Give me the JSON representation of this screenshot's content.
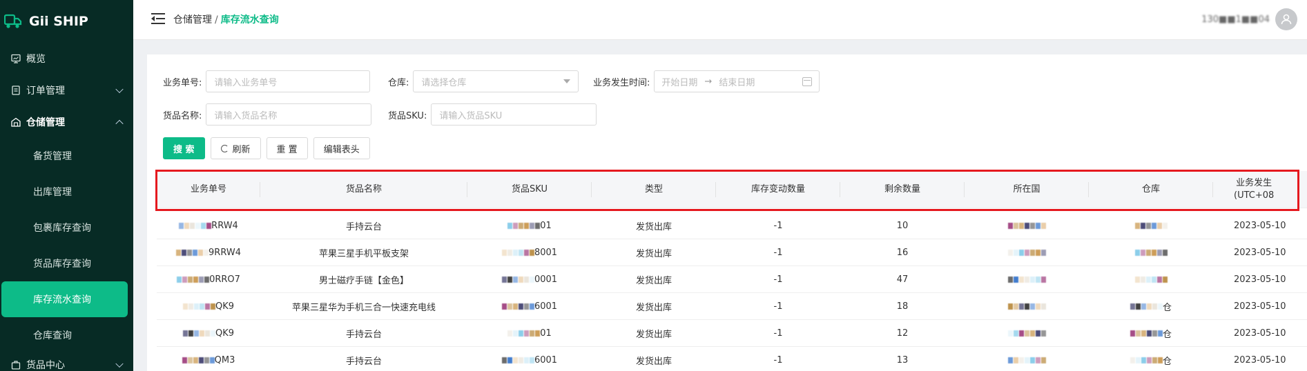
{
  "brand": {
    "name": "Gii SHIP"
  },
  "sidebar": {
    "items": [
      {
        "label": "概览",
        "icon": "monitor-icon"
      },
      {
        "label": "订单管理",
        "icon": "order-icon",
        "chevron": "down"
      },
      {
        "label": "仓储管理",
        "icon": "warehouse-icon",
        "chevron": "up"
      }
    ],
    "sub_items": [
      "备货管理",
      "出库管理",
      "包裹库存查询",
      "货品库存查询",
      "库存流水查询",
      "仓库查询"
    ],
    "more_item": "货品中心"
  },
  "header": {
    "breadcrumb_parent": "仓储管理",
    "breadcrumb_sep": "/",
    "breadcrumb_current": "库存流水查询",
    "username": "130■■1■■04"
  },
  "filters": {
    "order_no_label": "业务单号:",
    "order_no_placeholder": "请输入业务单号",
    "warehouse_label": "仓库:",
    "warehouse_placeholder": "请选择仓库",
    "time_label": "业务发生时间:",
    "start_placeholder": "开始日期",
    "range_sep": "→",
    "end_placeholder": "结束日期",
    "goods_name_label": "货品名称:",
    "goods_name_placeholder": "请输入货品名称",
    "sku_label": "货品SKU:",
    "sku_placeholder": "请输入货品SKU"
  },
  "buttons": {
    "search": "搜 索",
    "refresh": "刷新",
    "reset": "重 置",
    "edit_header": "编辑表头"
  },
  "table": {
    "columns": [
      "业务单号",
      "货品名称",
      "货品SKU",
      "类型",
      "库存变动数量",
      "剩余数量",
      "所在国",
      "仓库",
      "业务发生\n(UTC+08"
    ],
    "rows": [
      {
        "order_tail": "RRW4",
        "name": "手持云台",
        "sku_tail": "01",
        "type": "发货出库",
        "change": "-1",
        "remain": "10",
        "wh_tail": "",
        "time": "2023-05-10"
      },
      {
        "order_tail": "9RRW4",
        "name": "苹果三星手机平板支架",
        "sku_tail": "8001",
        "type": "发货出库",
        "change": "-1",
        "remain": "16",
        "wh_tail": "",
        "time": "2023-05-10"
      },
      {
        "order_tail": "0RRO7",
        "name": "男士磁疗手链【金色】",
        "sku_tail": "0001",
        "type": "发货出库",
        "change": "-1",
        "remain": "47",
        "wh_tail": "",
        "time": "2023-05-10"
      },
      {
        "order_tail": "QK9",
        "name": "苹果三星华为手机三合一快速充电线",
        "sku_tail": "6001",
        "type": "发货出库",
        "change": "-1",
        "remain": "18",
        "wh_tail": "仓",
        "time": "2023-05-10"
      },
      {
        "order_tail": "QK9",
        "name": "手持云台",
        "sku_tail": "01",
        "type": "发货出库",
        "change": "-1",
        "remain": "12",
        "wh_tail": "仓",
        "time": "2023-05-10"
      },
      {
        "order_tail": "QM3",
        "name": "手持云台",
        "sku_tail": "6001",
        "type": "发货出库",
        "change": "-1",
        "remain": "13",
        "wh_tail": "仓",
        "time": "2023-05-10"
      }
    ]
  },
  "colors": {
    "accent": "#0dbb88",
    "sidebar_bg": "#072b25",
    "highlight": "#e5191f"
  }
}
